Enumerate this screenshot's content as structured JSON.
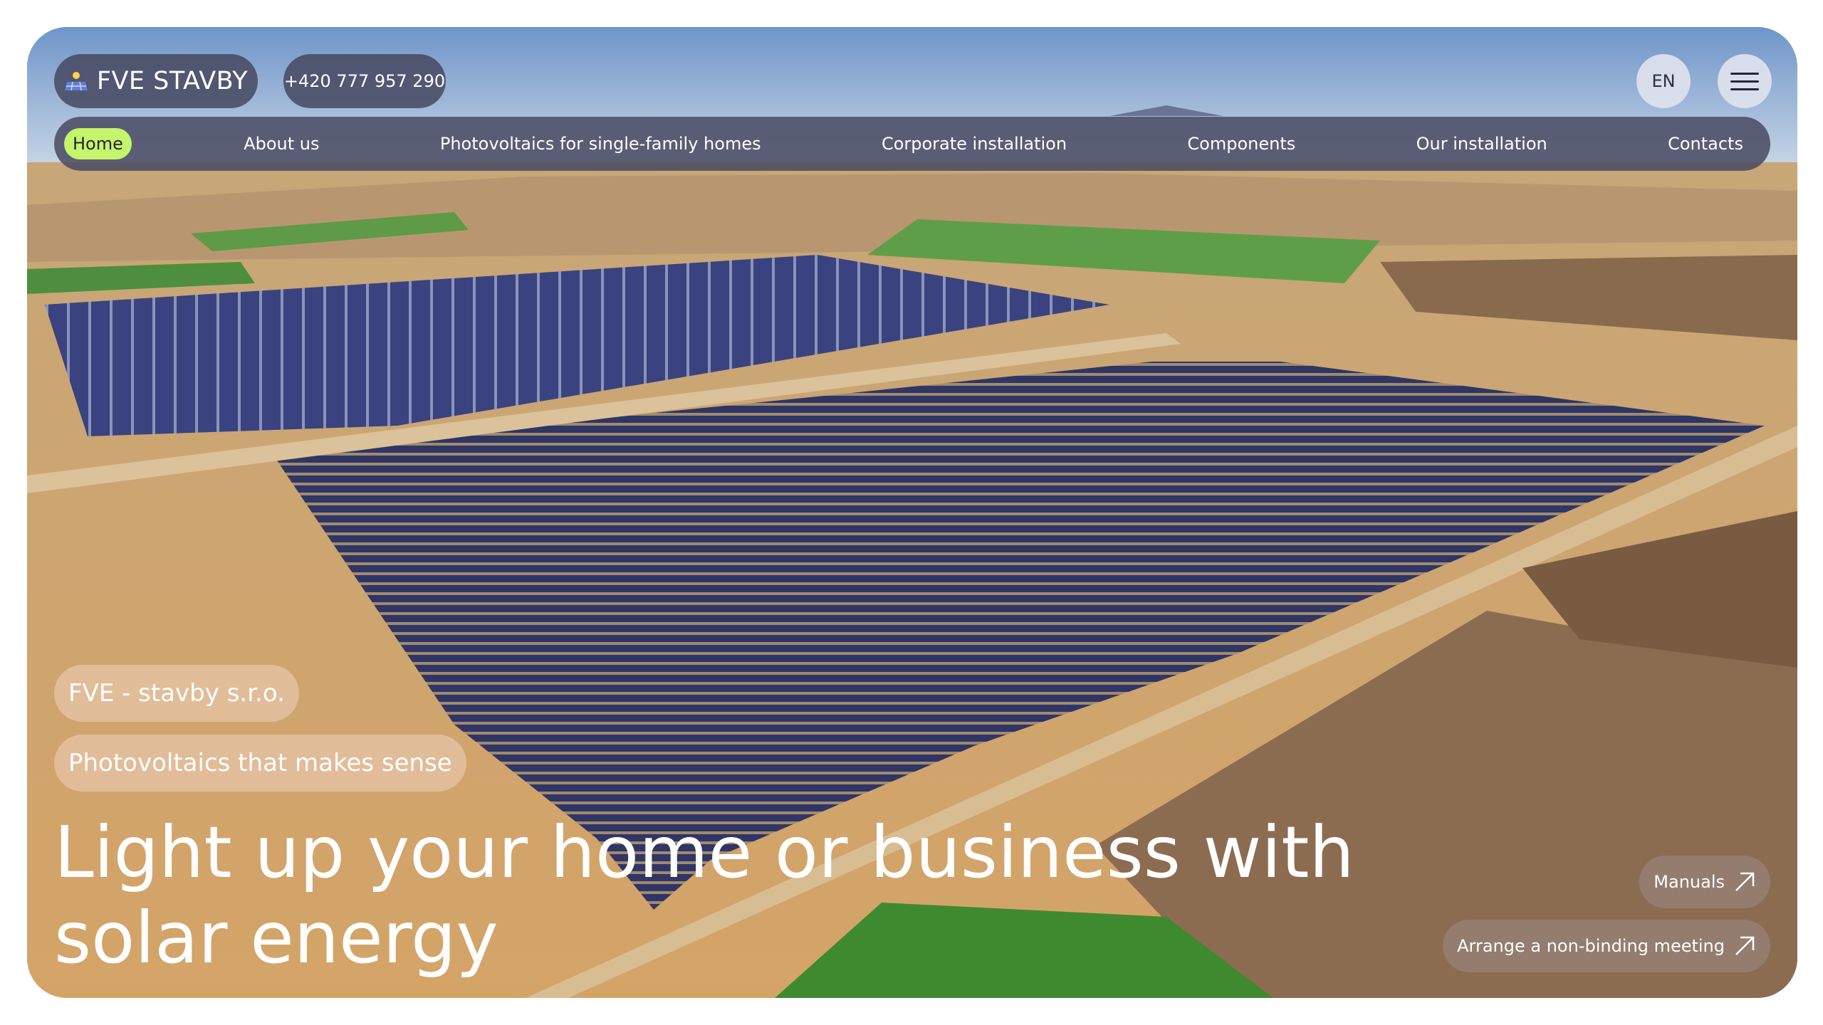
{
  "header": {
    "logo_text": "FVE STAVBY",
    "logo_icon": "solar-panel-icon",
    "phone": "+420 777 957 290",
    "language": "EN",
    "menu_icon": "hamburger-menu-icon"
  },
  "nav": {
    "items": [
      {
        "label": "Home",
        "active": true
      },
      {
        "label": "About us",
        "active": false
      },
      {
        "label": "Photovoltaics for single-family homes",
        "active": false
      },
      {
        "label": "Corporate installation",
        "active": false
      },
      {
        "label": "Components",
        "active": false
      },
      {
        "label": "Our installation",
        "active": false
      },
      {
        "label": "Contacts",
        "active": false
      }
    ]
  },
  "hero": {
    "company_tag": "FVE - stavby s.r.o.",
    "slogan_tag": "Photovoltaics that makes sense",
    "headline": "Light up your home or business with solar energy",
    "background": "aerial-solar-farm-photo"
  },
  "actions": {
    "manuals_label": "Manuals",
    "meeting_label": "Arrange a non-binding meeting",
    "arrow_icon": "arrow-up-right-icon"
  },
  "colors": {
    "accent": "#c5f56a",
    "nav_bg": "#484a62",
    "tag_bg": "#eccbb4"
  }
}
